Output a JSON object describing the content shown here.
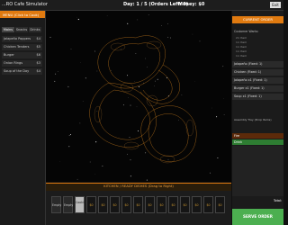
{
  "header": {
    "app_title": "...RO Cafe Simulator",
    "day_status": "Day: 1 / 5 (Orders Left: 9)",
    "money": "Money: $0",
    "close_label": "Exit"
  },
  "menu": {
    "title": "MENU (Click to Cook)",
    "tabs": [
      "Mains",
      "Snacks",
      "Drinks"
    ],
    "items": [
      {
        "name": "Jalapeño Poppers",
        "price": "$4"
      },
      {
        "name": "Chicken Tenders",
        "price": "$5"
      },
      {
        "name": "Burger",
        "price": "$6"
      },
      {
        "name": "Onion Rings",
        "price": "$3"
      },
      {
        "name": "Soup of the Day",
        "price": "$4"
      }
    ]
  },
  "order": {
    "title": "CURRENT ORDER",
    "customer_wants_label": "Customer Wants:",
    "wants": [
      "2× Item",
      "1× Item",
      "1× Item",
      "1× Item",
      "1× Item"
    ],
    "lines": [
      "Jalapeño (Fixed: 1)",
      "Chicken (Fixed: 1)",
      "Jalapeño x1 (Fixed: 1)",
      "Burger x1 (Fixed: 1)",
      "Soup x1 (Fixed: 1)"
    ],
    "tray_label": "Assembly Tray (Drop Items)",
    "tray_items": [
      "Fire",
      "Drink"
    ],
    "total_label": "Total:",
    "serve_label": "SERVE ORDER"
  },
  "kitchen": {
    "title": "KITCHEN / READY DISHES (Drag to Right)",
    "slots": [
      {
        "state": "empty",
        "label": "Empty"
      },
      {
        "state": "empty",
        "label": "Empty"
      },
      {
        "state": "cooking",
        "label": "Cooking..."
      },
      {
        "state": "locked",
        "label": "$0"
      },
      {
        "state": "locked",
        "label": "$0"
      },
      {
        "state": "locked",
        "label": "$0"
      },
      {
        "state": "locked",
        "label": "$0"
      },
      {
        "state": "locked",
        "label": "$0"
      },
      {
        "state": "locked",
        "label": "$0"
      },
      {
        "state": "locked",
        "label": "$0"
      },
      {
        "state": "locked",
        "label": "$0"
      },
      {
        "state": "locked",
        "label": "$0"
      },
      {
        "state": "locked",
        "label": "$0"
      },
      {
        "state": "locked",
        "label": "$0"
      },
      {
        "state": "locked",
        "label": "$0"
      }
    ]
  },
  "colors": {
    "accent": "#e07a10",
    "serve": "#4caf50",
    "tray_fire": "#5c2a0a",
    "tray_drink": "#2e7d32"
  }
}
